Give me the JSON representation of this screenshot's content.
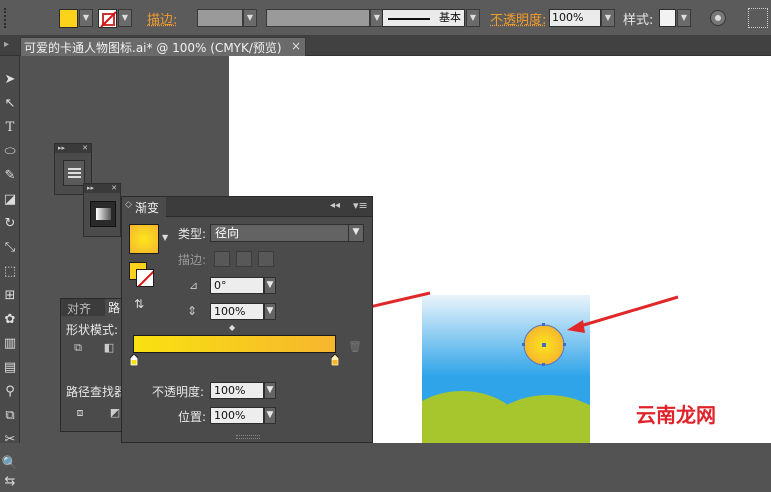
{
  "control_bar": {
    "stroke_label": "描边:",
    "stroke_style": "基本",
    "opacity_label": "不透明度:",
    "opacity_value": "100%",
    "style_label": "样式:",
    "fill_color": "#fcd21a"
  },
  "document": {
    "tab_title": "可爱的卡通人物图标.ai* @ 100% (CMYK/预览)",
    "close": "×"
  },
  "gradient_panel": {
    "title": "渐变",
    "type_label": "类型:",
    "type_value": "径向",
    "stroke_label": "描边:",
    "angle_value": "0°",
    "aspect_value": "100%",
    "opacity_label": "不透明度:",
    "opacity_value": "100%",
    "location_label": "位置:",
    "location_value": "100%",
    "gradient_start": "#f8e111",
    "gradient_end": "#f6b62e"
  },
  "pathfinder_panel": {
    "tab_align": "对齐",
    "tab_pathfinder": "路",
    "shape_modes_label": "形状模式:",
    "pathfinders_label": "路径查找器"
  },
  "watermark": "云南龙网",
  "colors": {
    "arrow": "#e0282a",
    "sky_top": "#e9f4fb",
    "sky_bottom": "#2ea3e8",
    "hill": "#a6c32c",
    "sun": "#f7b92a"
  }
}
